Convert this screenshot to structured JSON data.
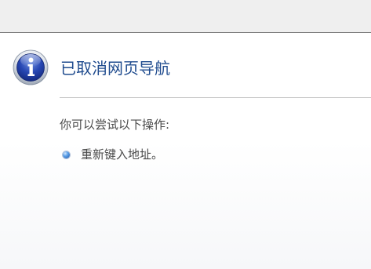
{
  "page": {
    "title": "已取消网页导航",
    "subheading": "你可以尝试以下操作:",
    "suggestions": [
      {
        "text": "重新键入地址。"
      }
    ],
    "icon": "info-icon",
    "colors": {
      "title": "#1f4b8e",
      "body_text": "#4a4a4a",
      "top_bar": "#efefef"
    }
  }
}
